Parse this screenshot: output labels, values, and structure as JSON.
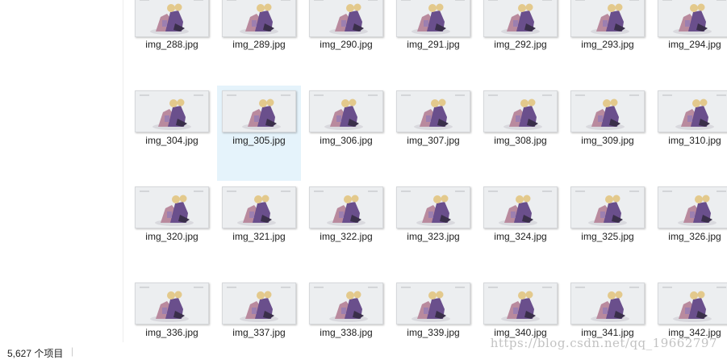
{
  "window": {
    "status_count": "5,627 个项目",
    "status_separator": "|"
  },
  "watermark": "https://blog.csdn.net/qq_19662797",
  "files": {
    "rows": [
      [
        "img_288.jpg",
        "img_289.jpg",
        "img_290.jpg",
        "img_291.jpg",
        "img_292.jpg",
        "img_293.jpg",
        "img_294.jpg"
      ],
      [
        "img_304.jpg",
        "img_305.jpg",
        "img_306.jpg",
        "img_307.jpg",
        "img_308.jpg",
        "img_309.jpg",
        "img_310.jpg"
      ],
      [
        "img_320.jpg",
        "img_321.jpg",
        "img_322.jpg",
        "img_323.jpg",
        "img_324.jpg",
        "img_325.jpg",
        "img_326.jpg"
      ],
      [
        "img_336.jpg",
        "img_337.jpg",
        "img_338.jpg",
        "img_339.jpg",
        "img_340.jpg",
        "img_341.jpg",
        "img_342.jpg"
      ]
    ],
    "selected": "img_305.jpg"
  },
  "colors": {
    "selection": "#e5f3fb",
    "figure_purple": "#6a4f8c",
    "figure_pink": "#b98a9e",
    "figure_hair": "#e3c98c",
    "figure_dark": "#3a2f4a"
  },
  "icons": {
    "thumbnail": "jpg-thumbnail-icon"
  }
}
